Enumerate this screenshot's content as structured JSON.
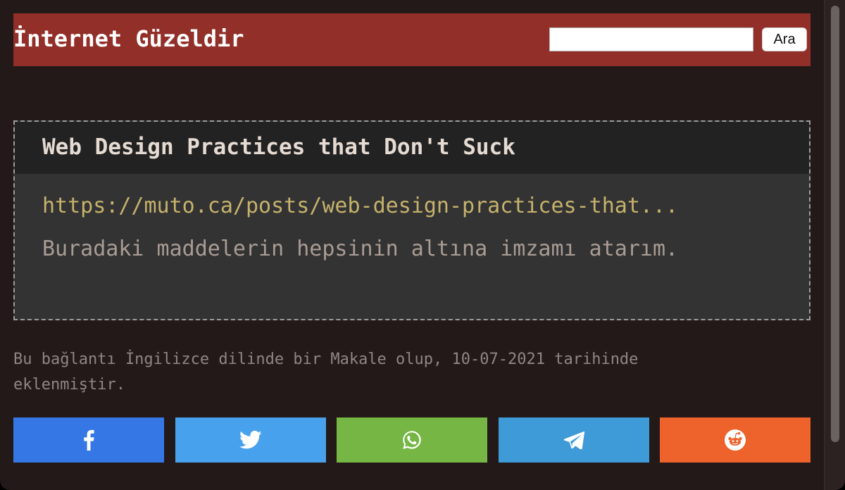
{
  "header": {
    "site_title": "İnternet Güzeldir",
    "search_placeholder": "",
    "search_button": "Ara"
  },
  "card": {
    "title": "Web Design Practices that Don't Suck",
    "link": "https://muto.ca/posts/web-design-practices-that...",
    "description": "Buradaki maddelerin hepsinin altına imzamı atarım."
  },
  "meta": {
    "text": "Bu bağlantı İngilizce dilinde bir Makale olup, 10-07-2021 tarihinde eklenmiştir."
  },
  "share": [
    {
      "name": "facebook",
      "icon": "facebook-icon",
      "color": "#3578e5"
    },
    {
      "name": "twitter",
      "icon": "twitter-icon",
      "color": "#48a1ec"
    },
    {
      "name": "whatsapp",
      "icon": "whatsapp-icon",
      "color": "#76b644"
    },
    {
      "name": "telegram",
      "icon": "telegram-icon",
      "color": "#3e9bd8"
    },
    {
      "name": "reddit",
      "icon": "reddit-icon",
      "color": "#ee622c"
    }
  ],
  "colors": {
    "background": "#231918",
    "header": "#922f29",
    "card_head": "#222222",
    "card_body": "#333333",
    "link": "#c6b26c"
  }
}
